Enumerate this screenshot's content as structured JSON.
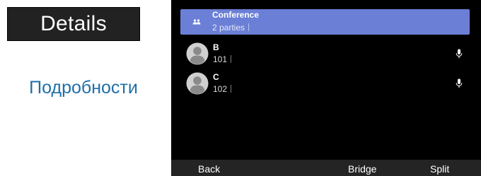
{
  "label": {
    "title": "Details",
    "translation": "Подробности"
  },
  "colors": {
    "selected_row": "#6b7fd6",
    "translation_text": "#1f6fa8",
    "screen_bg": "#000000",
    "softkey_bar": "#242424"
  },
  "conference": {
    "title": "Conference",
    "subtitle": "2 parties",
    "icon": "group-icon"
  },
  "participants": [
    {
      "name": "B",
      "number": "101",
      "icon": "avatar",
      "action_icon": "microphone-icon"
    },
    {
      "name": "C",
      "number": "102",
      "icon": "avatar",
      "action_icon": "microphone-icon"
    }
  ],
  "softkeys": {
    "back": "Back",
    "bridge": "Bridge",
    "split": "Split"
  }
}
